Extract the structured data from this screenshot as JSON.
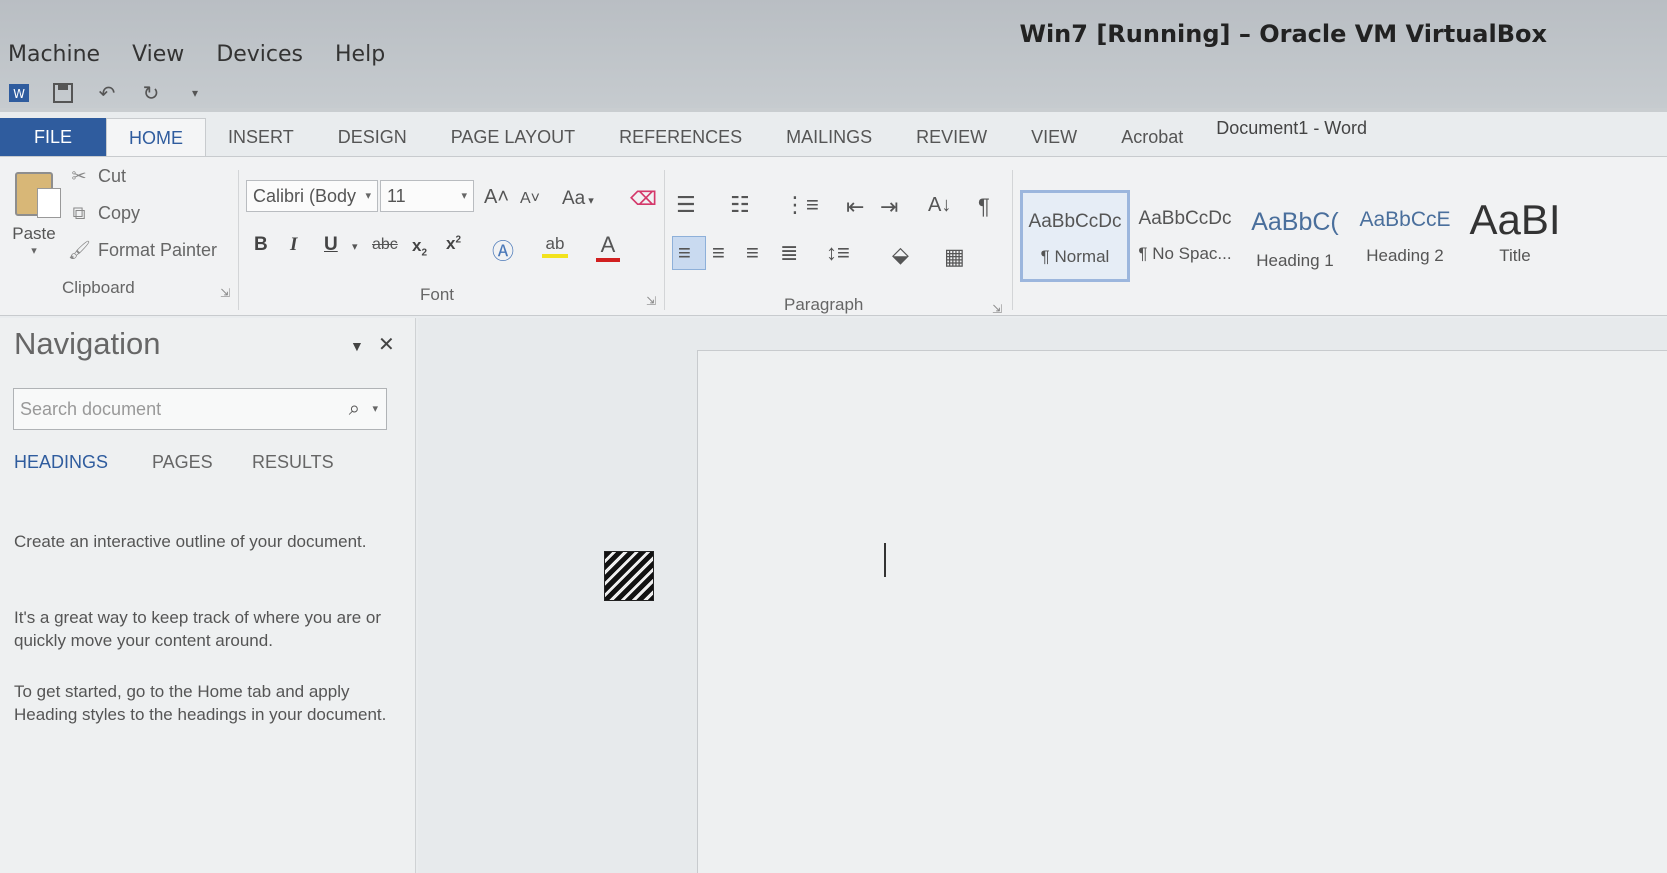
{
  "vbox": {
    "title": "Win7 [Running] – Oracle VM VirtualBox",
    "menu": [
      "Machine",
      "View",
      "Devices",
      "Help"
    ]
  },
  "quick_access": {
    "icons": [
      "word-app-icon",
      "save-icon",
      "undo-icon",
      "redo-icon",
      "customize-qat-icon"
    ]
  },
  "word": {
    "doc_title": "Document1 - Word",
    "tabs": [
      "FILE",
      "HOME",
      "INSERT",
      "DESIGN",
      "PAGE LAYOUT",
      "REFERENCES",
      "MAILINGS",
      "REVIEW",
      "VIEW",
      "Acrobat"
    ],
    "active_tab": "HOME"
  },
  "ribbon": {
    "clipboard": {
      "paste": "Paste",
      "cut": "Cut",
      "copy": "Copy",
      "format_painter": "Format Painter",
      "label": "Clipboard"
    },
    "font": {
      "font_name": "Calibri (Body",
      "font_size": "11",
      "case": "Aa",
      "bold": "B",
      "italic": "I",
      "underline": "U",
      "strikethrough": "abc",
      "subscript": "x",
      "superscript": "x",
      "label": "Font"
    },
    "paragraph": {
      "label": "Paragraph"
    },
    "styles": [
      {
        "sample": "AaBbCcDc",
        "name": "¶ Normal",
        "selected": true
      },
      {
        "sample": "AaBbCcDc",
        "name": "¶ No Spac...",
        "selected": false
      },
      {
        "sample": "AaBbC(",
        "name": "Heading 1",
        "selected": false
      },
      {
        "sample": "AaBbCcE",
        "name": "Heading 2",
        "selected": false
      },
      {
        "sample": "AaBI",
        "name": "Title",
        "selected": false
      }
    ]
  },
  "navigation": {
    "title": "Navigation",
    "search_placeholder": "Search document",
    "tabs": [
      "HEADINGS",
      "PAGES",
      "RESULTS"
    ],
    "active_tab": "HEADINGS",
    "paragraphs": [
      "Create an interactive outline of your document.",
      "It's a great way to keep track of where you are or quickly move your content around.",
      "To get started, go to the Home tab and apply Heading styles to the headings in your document."
    ]
  },
  "colors": {
    "accent": "#2f5c9e",
    "font_color_bar": "#d11f1f",
    "highlight_bar": "#f2e21c"
  }
}
